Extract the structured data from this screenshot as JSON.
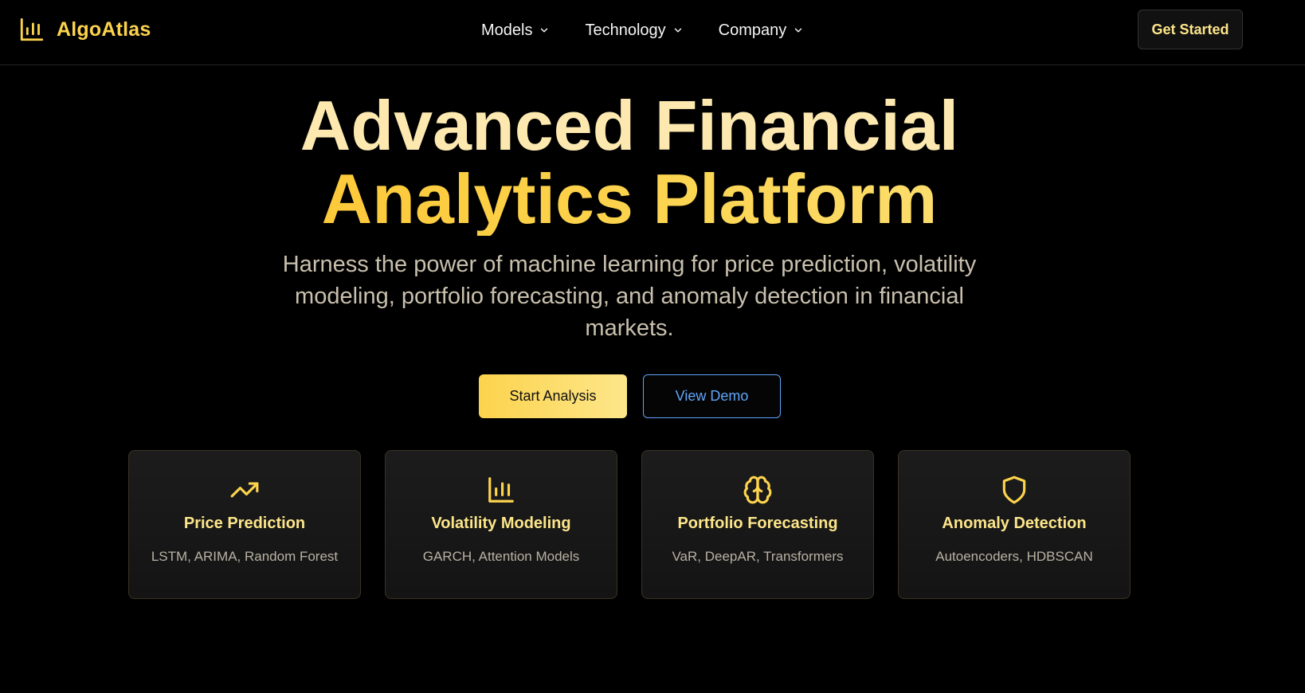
{
  "brand": {
    "name": "AlgoAtlas",
    "icon": "bar-chart-icon"
  },
  "nav": {
    "links": [
      {
        "label": "Models",
        "icon": "chevron-down-icon"
      },
      {
        "label": "Technology",
        "icon": "chevron-down-icon"
      },
      {
        "label": "Company",
        "icon": "chevron-down-icon"
      }
    ],
    "cta": "Get Started"
  },
  "hero": {
    "title_line1": "Advanced Financial",
    "title_line2": "Analytics Platform",
    "subtitle": "Harness the power of machine learning for price prediction, volatility modeling, portfolio forecasting, and anomaly detection in financial markets.",
    "primary_cta": "Start Analysis",
    "secondary_cta": "View Demo"
  },
  "features": [
    {
      "title": "Price Prediction",
      "subtitle": "LSTM, ARIMA, Random Forest",
      "icon": "trending-up-icon"
    },
    {
      "title": "Volatility Modeling",
      "subtitle": "GARCH, Attention Models",
      "icon": "bar-chart-icon"
    },
    {
      "title": "Portfolio Forecasting",
      "subtitle": "VaR, DeepAR, Transformers",
      "icon": "brain-icon"
    },
    {
      "title": "Anomaly Detection",
      "subtitle": "Autoencoders, HDBSCAN",
      "icon": "shield-icon"
    }
  ],
  "colors": {
    "background": "#000000",
    "accent": "#fcd34d",
    "accent_light": "#fde68a",
    "link_blue": "#60a5fa"
  }
}
